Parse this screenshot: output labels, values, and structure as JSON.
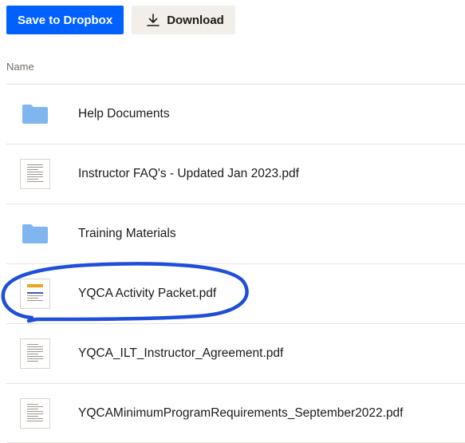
{
  "toolbar": {
    "save_label": "Save to Dropbox",
    "download_label": "Download",
    "download_icon": "download-icon"
  },
  "table": {
    "column_name": "Name"
  },
  "files": [
    {
      "name": "Help Documents",
      "type": "folder",
      "icon": "folder-icon"
    },
    {
      "name": "Instructor FAQ's - Updated Jan 2023.pdf",
      "type": "pdf",
      "icon": "pdf-thumbnail"
    },
    {
      "name": "Training Materials",
      "type": "folder",
      "icon": "folder-icon"
    },
    {
      "name": "YQCA Activity Packet.pdf",
      "type": "pdf",
      "icon": "pdf-thumbnail",
      "highlighted": true
    },
    {
      "name": "YQCA_ILT_Instructor_Agreement.pdf",
      "type": "pdf",
      "icon": "pdf-thumbnail"
    },
    {
      "name": "YQCAMinimumProgramRequirements_September2022.pdf",
      "type": "pdf",
      "icon": "pdf-thumbnail"
    }
  ],
  "colors": {
    "primary": "#0061fe",
    "secondary_bg": "#f2efea",
    "folder": "#7fb6f0",
    "annotation": "#1f4fd8"
  }
}
